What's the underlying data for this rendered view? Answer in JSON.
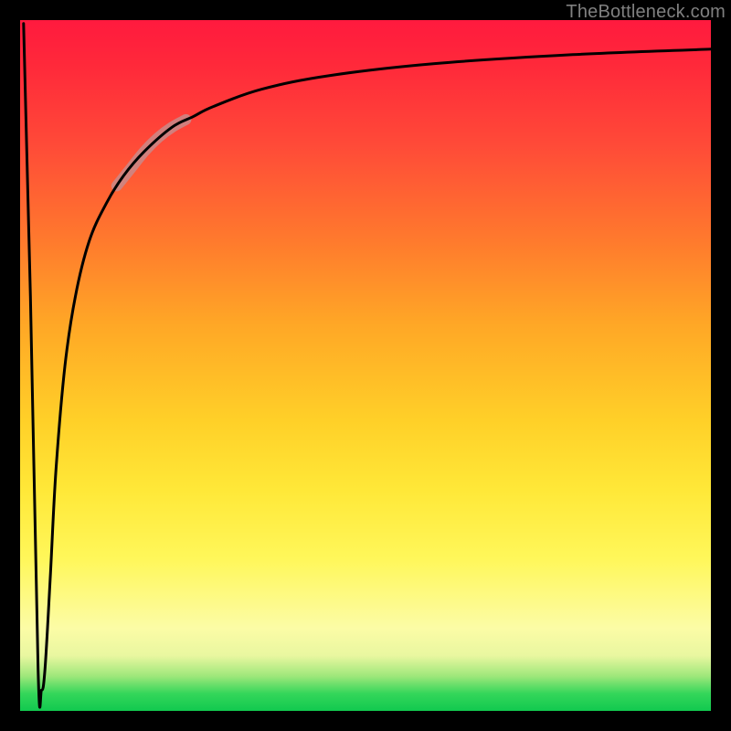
{
  "attribution": "TheBottleneck.com",
  "chart_data": {
    "type": "line",
    "title": "",
    "xlabel": "",
    "ylabel": "",
    "xlim": [
      0,
      100
    ],
    "ylim": [
      0,
      100
    ],
    "background_gradient": {
      "direction": "top-to-bottom",
      "stops": [
        {
          "pos": 0,
          "color": "#ff1a3e"
        },
        {
          "pos": 18,
          "color": "#ff4a38"
        },
        {
          "pos": 44,
          "color": "#ffa726"
        },
        {
          "pos": 68,
          "color": "#ffe838"
        },
        {
          "pos": 88,
          "color": "#fcfca6"
        },
        {
          "pos": 97,
          "color": "#34d65a"
        },
        {
          "pos": 100,
          "color": "#11c94f"
        }
      ]
    },
    "series": [
      {
        "name": "bottleneck-curve",
        "stroke": "#000000",
        "stroke_width": 3,
        "x": [
          0.5,
          1.5,
          2.6,
          3.1,
          3.6,
          4.4,
          5.2,
          6.5,
          8.0,
          10.0,
          12.5,
          15.0,
          18.0,
          22.0,
          25.0,
          28.0,
          35.0,
          45.0,
          60.0,
          80.0,
          100.0
        ],
        "y": [
          99.5,
          60.0,
          6.0,
          3.0,
          6.0,
          20.0,
          35.0,
          50.0,
          60.0,
          68.0,
          73.5,
          77.5,
          81.0,
          84.5,
          86.0,
          87.5,
          90.0,
          92.0,
          93.7,
          95.0,
          95.8
        ]
      },
      {
        "name": "highlight-segment",
        "stroke": "#c98a8a",
        "stroke_width": 12,
        "opacity": 0.85,
        "x": [
          14.0,
          16.0,
          18.0,
          20.0,
          22.0,
          24.0
        ],
        "y": [
          76.0,
          78.5,
          81.0,
          83.0,
          84.5,
          85.6
        ]
      }
    ]
  }
}
